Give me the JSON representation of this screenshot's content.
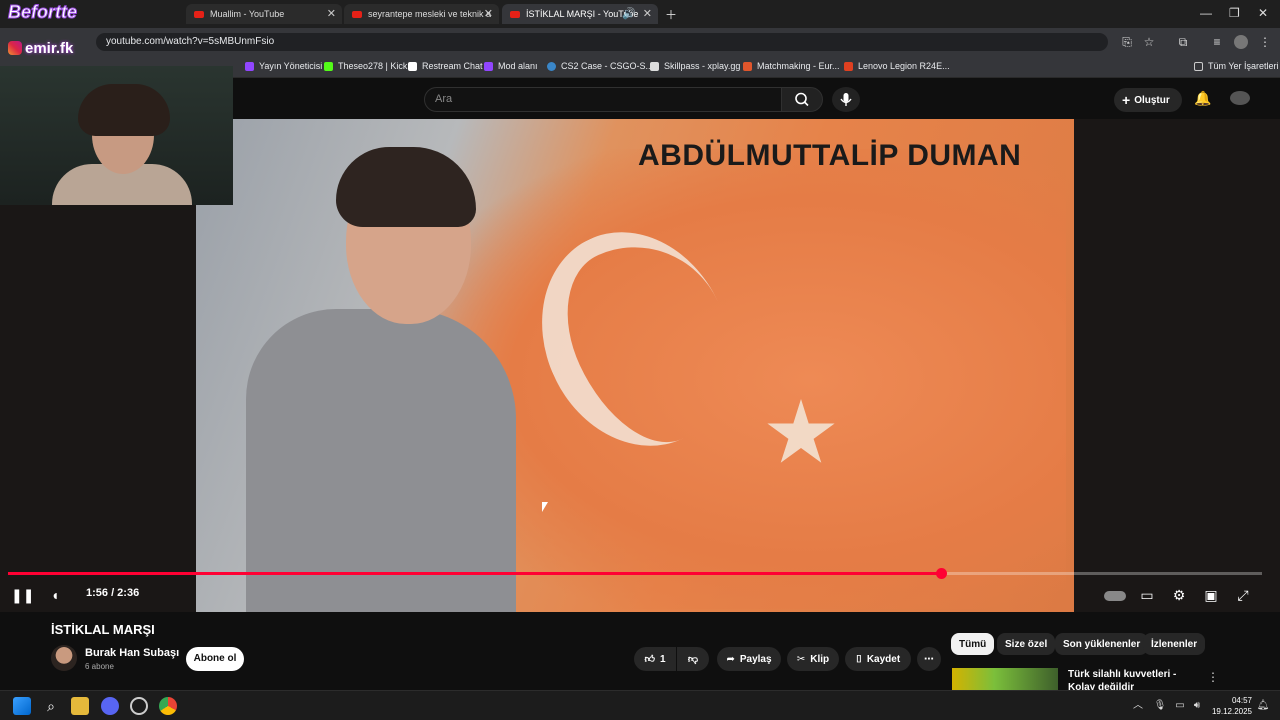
{
  "browser": {
    "tabs": [
      {
        "title": "Muallim - YouTube",
        "active": false
      },
      {
        "title": "seyrantepe mesleki ve teknik a",
        "active": false
      },
      {
        "title": "İSTİKLAL MARŞI - YouTube",
        "active": true
      }
    ],
    "url": "youtube.com/watch?v=5sMBUnmFsio",
    "bookmarks": [
      "Yayın Yöneticisi",
      "Theseo278 | Kick",
      "Restream Chat",
      "Mod alanı",
      "CS2 Case - CSGO-S...",
      "Skillpass - xplay.gg",
      "Matchmaking - Eur...",
      "Lenovo Legion R24E..."
    ],
    "all_bookmarks": "Tüm Yer İşaretleri"
  },
  "overlay": {
    "brand": "Befortte",
    "instagram": "emir.fk"
  },
  "youtube": {
    "search_placeholder": "Ara",
    "create_label": "Oluştur",
    "video": {
      "caption_name": "ABDÜLMUTTALİP DUMAN",
      "time_current": "1:56",
      "time_total": "2:36",
      "time_display": "1:56 / 2:36",
      "progress_fraction": 0.744
    },
    "title": "İSTİKLAL MARŞI",
    "channel": "Burak Han Subaşı",
    "subscribers": "6 abone",
    "subscribe_label": "Abone ol",
    "likes": "1",
    "share_label": "Paylaş",
    "clip_label": "Klip",
    "save_label": "Kaydet",
    "chips": [
      "Tümü",
      "Size özel",
      "Son yüklenenler",
      "İzlenenler"
    ],
    "recommendation_title": "Türk silahlı kuvvetleri - Kolay değildir"
  },
  "taskbar": {
    "time": "04:57",
    "date": "19.12.2025"
  },
  "colors": {
    "accent": "#ff0033",
    "background": "#0f0f0f"
  }
}
